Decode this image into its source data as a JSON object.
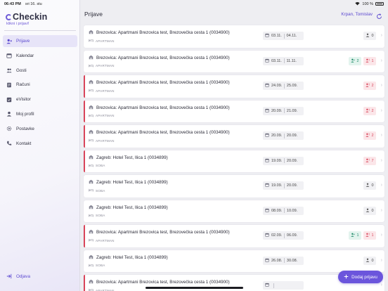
{
  "status": {
    "time": "06:43 PM",
    "date": "sri 16. stu",
    "battery": "100 %"
  },
  "brand": {
    "name": "Checkin",
    "tagline": "klikni i prijavi!"
  },
  "nav": [
    {
      "label": "Prijave",
      "icon": "person-add-icon",
      "active": true
    },
    {
      "label": "Kalendar",
      "icon": "calendar-icon"
    },
    {
      "label": "Gosti",
      "icon": "users-icon"
    },
    {
      "label": "Računi",
      "icon": "invoice-icon"
    },
    {
      "label": "eVisitor",
      "icon": "evisitor-icon"
    },
    {
      "label": "Moj profil",
      "icon": "profile-icon"
    },
    {
      "label": "Postavke",
      "icon": "gear-icon"
    },
    {
      "label": "Kontakt",
      "icon": "phone-icon"
    }
  ],
  "logout": {
    "label": "Odjava"
  },
  "header": {
    "title": "Prijave",
    "user": "Krpan, Tomislav"
  },
  "fab": {
    "label": "Dodaj prijavu"
  },
  "colors": {
    "accent": "#6b55dc",
    "danger": "#d9455a",
    "success": "#1f8a68"
  },
  "bookings": [
    {
      "title": "Brezovica: Apartmani Brezovica test, Brezovečka cesta 1 (0034900)",
      "type": "APARTMAN",
      "from": "03.11.",
      "to": "04.11.",
      "flag": false,
      "badges": [
        {
          "kind": "neutral",
          "icon": "person-icon",
          "value": "0"
        }
      ]
    },
    {
      "title": "Brezovica: Apartmani Brezovica test, Brezovečka cesta 1 (0034900)",
      "type": "APARTMAN",
      "from": "03.11.",
      "to": "11.11.",
      "flag": false,
      "badges": [
        {
          "kind": "green",
          "icon": "person-check-icon",
          "value": "2"
        },
        {
          "kind": "red",
          "icon": "person-alert-icon",
          "value": "1"
        }
      ]
    },
    {
      "title": "Brezovica: Apartmani Brezovica test, Brezovečka cesta 1 (0034900)",
      "type": "APARTMAN",
      "from": "24.09.",
      "to": "25.09.",
      "flag": true,
      "badges": [
        {
          "kind": "red",
          "icon": "person-alert-icon",
          "value": "2"
        }
      ]
    },
    {
      "title": "Brezovica: Apartmani Brezovica test, Brezovečka cesta 1 (0034900)",
      "type": "APARTMAN",
      "from": "20.09.",
      "to": "21.09.",
      "flag": true,
      "badges": [
        {
          "kind": "red",
          "icon": "person-alert-icon",
          "value": "2"
        }
      ]
    },
    {
      "title": "Brezovica: Apartmani Brezovica test, Brezovečka cesta 1 (0034900)",
      "type": "APARTMAN",
      "from": "20.09.",
      "to": "20.09.",
      "flag": true,
      "badges": [
        {
          "kind": "red",
          "icon": "person-alert-icon",
          "value": "2"
        }
      ]
    },
    {
      "title": "Zagreb: Hotel Test, Ilica 1 (0034899)",
      "type": "SOBA",
      "from": "19.09.",
      "to": "20.09.",
      "flag": true,
      "badges": [
        {
          "kind": "red",
          "icon": "person-alert-icon",
          "value": "7"
        }
      ]
    },
    {
      "title": "Zagreb: Hotel Test, Ilica 1 (0034899)",
      "type": "SOBA",
      "from": "19.09.",
      "to": "20.09.",
      "flag": false,
      "badges": [
        {
          "kind": "neutral",
          "icon": "person-icon",
          "value": "0"
        }
      ]
    },
    {
      "title": "Zagreb: Hotel Test, Ilica 1 (0034899)",
      "type": "SOBA",
      "from": "08.09.",
      "to": "10.09.",
      "flag": false,
      "badges": [
        {
          "kind": "neutral",
          "icon": "person-icon",
          "value": "0"
        }
      ]
    },
    {
      "title": "Brezovica: Apartmani Brezovica test, Brezovečka cesta 1 (0034900)",
      "type": "APARTMAN",
      "from": "02.09.",
      "to": "06.09.",
      "flag": true,
      "badges": [
        {
          "kind": "green",
          "icon": "person-check-icon",
          "value": "1"
        },
        {
          "kind": "red",
          "icon": "person-alert-icon",
          "value": "1"
        }
      ]
    },
    {
      "title": "Zagreb: Hotel Test, Ilica 1 (0034899)",
      "type": "SOBA",
      "from": "26.08.",
      "to": "30.08.",
      "flag": false,
      "badges": [
        {
          "kind": "neutral",
          "icon": "person-icon",
          "value": "0"
        }
      ]
    },
    {
      "title": "Brezovica: Apartmani Brezovica test, Brezovečka cesta 1 (0034900)",
      "type": "APARTMAN",
      "from": "",
      "to": "",
      "flag": true,
      "badges": []
    }
  ]
}
